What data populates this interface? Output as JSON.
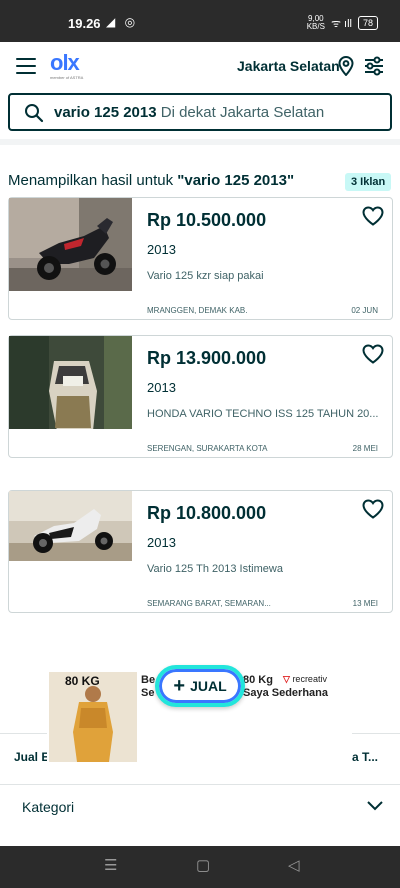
{
  "status_bar": {
    "time": "19.26",
    "left_icons": "◢ ◎",
    "speed_top": "9,00",
    "speed_bottom": "KB/S",
    "signal": "ᯤ ıll",
    "battery": "78"
  },
  "header": {
    "logo_text": "olx",
    "logo_sub": "member of ASTRA",
    "location": "Jakarta Selatan"
  },
  "search": {
    "query": "vario 125 2013",
    "near_text": " Di dekat Jakarta Selatan"
  },
  "results": {
    "prefix": "Menampilkan hasil untuk ",
    "query_quoted": "\"vario 125 2013\"",
    "count_label": "3 Iklan"
  },
  "listings": [
    {
      "price": "Rp 10.500.000",
      "year": "2013",
      "title": "Vario 125 kzr siap pakai",
      "location": "MRANGGEN, DEMAK KAB.",
      "date": "02 JUN"
    },
    {
      "price": "Rp 13.900.000",
      "year": "2013",
      "title": "HONDA VARIO TECHNO ISS 125 TAHUN 20...",
      "location": "SERENGAN, SURAKARTA KOTA",
      "date": "28 MEI"
    },
    {
      "price": "Rp 10.800.000",
      "year": "2013",
      "title": "Vario 125 Th 2013 Istimewa",
      "location": "SEMARANG BARAT, SEMARAN...",
      "date": "13 MEI"
    }
  ],
  "ad": {
    "image_label": "80 KG",
    "text_left_1": "Be",
    "text_left_2": "Se",
    "text_right_1": "80 Kg",
    "text_right_2": "Saya Sederhana",
    "brand": "recreativ"
  },
  "fab": {
    "label": "JUAL"
  },
  "footer_strip": {
    "left_label": "Jual E",
    "right_label": "a T..."
  },
  "kategori": {
    "label": "Kategori"
  },
  "nav_bar": {
    "recent": "☰",
    "home": "▢",
    "back": "◁"
  }
}
